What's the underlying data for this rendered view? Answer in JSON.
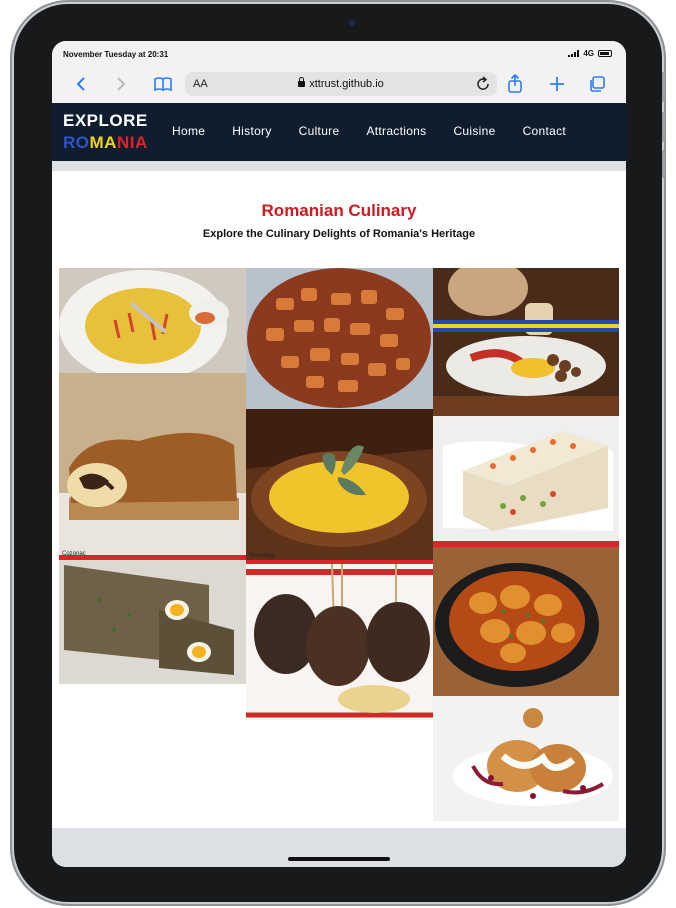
{
  "status": {
    "time": "November Tuesday at 20:31",
    "network": "4G"
  },
  "browser": {
    "text_size": "AA",
    "url": "xttrust.github.io"
  },
  "site": {
    "logo_top": "EXPLORE",
    "logo_bottom": [
      "RO",
      "MA",
      "NIA"
    ],
    "nav": [
      "Home",
      "History",
      "Culture",
      "Attractions",
      "Cuisine",
      "Contact"
    ]
  },
  "main": {
    "title": "Romanian Culinary",
    "subtitle": "Explore the Culinary Delights of Romania's Heritage",
    "gallery": [
      {
        "name": "soup-photo"
      },
      {
        "name": "fried-pork-photo"
      },
      {
        "name": "traditional-platter-photo"
      },
      {
        "name": "cozonac-photo",
        "caption": "Cozonac"
      },
      {
        "name": "mamaliga-photo",
        "caption": "Mamaliga"
      },
      {
        "name": "vegetable-aspic-photo"
      },
      {
        "name": "drob-photo"
      },
      {
        "name": "mici-photo"
      },
      {
        "name": "chicken-stew-photo"
      },
      {
        "name": "papanasi-photo"
      }
    ]
  },
  "colors": {
    "nav_bg": "#101d2f",
    "title_red": "#cc1a22",
    "flag_blue": "#2f53c8",
    "flag_yellow": "#f2d21b",
    "flag_red": "#e0232a"
  },
  "icons": [
    "back-icon",
    "forward-icon",
    "bookmarks-icon",
    "lock-icon",
    "reload-icon",
    "share-icon",
    "new-tab-icon",
    "tabs-icon"
  ]
}
